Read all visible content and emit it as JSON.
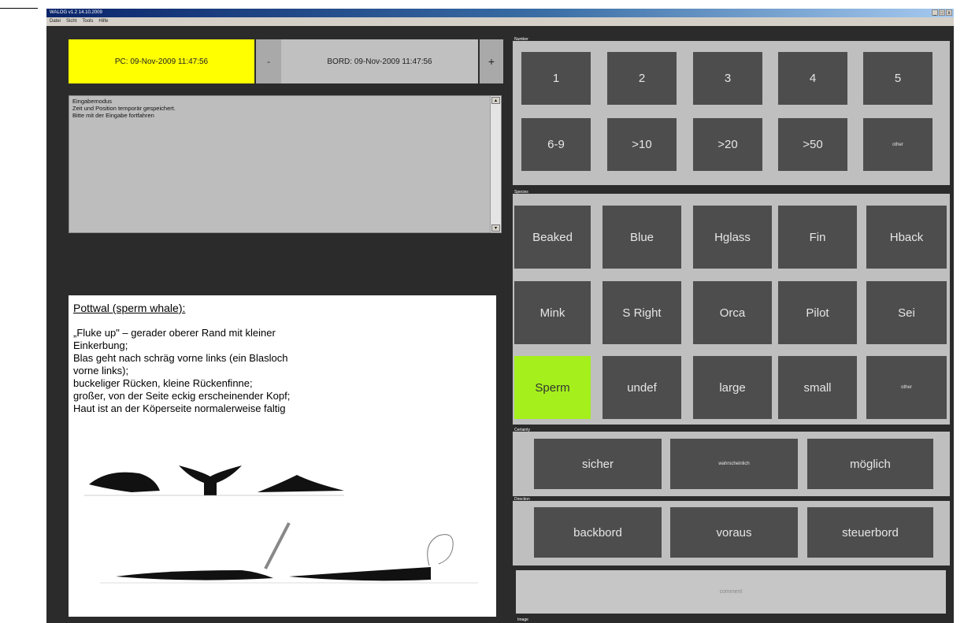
{
  "window": {
    "title": "WALOG v1.2 14.10.2009",
    "menu": [
      "Datei",
      "Sicht",
      "Tools",
      "Hilfe"
    ],
    "controls": [
      "_",
      "□",
      "x"
    ]
  },
  "timebar": {
    "pc_time": "PC: 09-Nov-2009 11:47:56",
    "minus": "-",
    "bord_time": "BORD: 09-Nov-2009 11:47:56",
    "plus": "+"
  },
  "status": {
    "lines": [
      "Eingabemodus",
      "Zeit und Position temporär gespeichert.",
      "Bitte mit der Eingabe fortfahren"
    ]
  },
  "info": {
    "heading": "Pottwal (sperm whale):",
    "lines": [
      "„Fluke up\" – gerader oberer Rand mit kleiner",
      "Einkerbung;",
      "Blas geht nach schräg vorne links (ein Blasloch",
      "vorne links);",
      "buckeliger Rücken, kleine Rückenfinne;",
      "großer, von der Seite eckig erscheinender Kopf;",
      "Haut ist an der Köperseite normalerweise faltig"
    ]
  },
  "groups": {
    "number_label": "Number",
    "number": [
      "1",
      "2",
      "3",
      "4",
      "5",
      "6-9",
      ">10",
      ">20",
      ">50",
      "other"
    ],
    "species_label": "Species",
    "species": [
      "Beaked",
      "Blue",
      "Hglass",
      "Fin",
      "Hback",
      "Mink",
      "S Right",
      "Orca",
      "Pilot",
      "Sei",
      "Sperm",
      "undef",
      "large",
      "small",
      "other"
    ],
    "species_selected": "Sperm",
    "certainty_label": "Certainty",
    "certainty": [
      "sicher",
      "wahrscheinlich",
      "möglich"
    ],
    "direction_label": "Direction",
    "direction": [
      "backbord",
      "voraus",
      "steuerbord"
    ],
    "comment": "comment",
    "bottom_label": "Image"
  },
  "colors": {
    "background": "#2b2b2b",
    "pc_time_bg": "#ffff00",
    "tile": "#4d4d4d",
    "selected_tile": "#a4ef1c",
    "group_bg": "#bfbfbf"
  }
}
